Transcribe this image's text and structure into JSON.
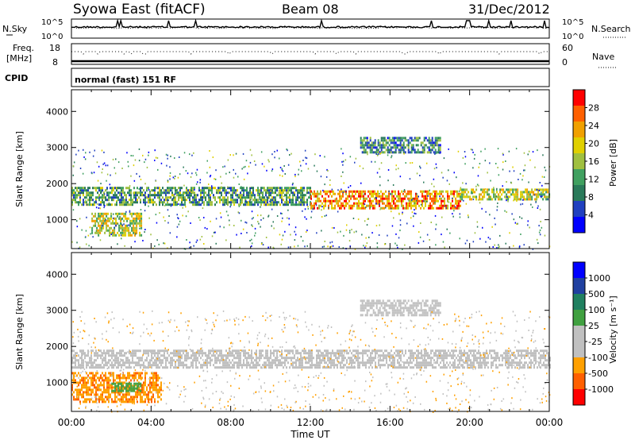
{
  "header": {
    "title": "Syowa East (fitACF)",
    "beam": "Beam 08",
    "date": "31/Dec/2012"
  },
  "strips": {
    "nsky_label": "N.Sky",
    "nsearch_label": "N.Search",
    "freq_label_1": "Freq.",
    "freq_label_2": "[MHz]",
    "nave_label": "Nave",
    "cpid_label": "CPID",
    "cpid_text": "normal (fast) 151 RF",
    "noise_ticks": [
      "10^5",
      "10^0"
    ],
    "freq_ticks": [
      "18",
      "8"
    ],
    "nave_ticks": [
      "60",
      "0"
    ]
  },
  "colors": {
    "power": [
      "#0000ff",
      "#2040c0",
      "#2a7a5a",
      "#40a060",
      "#a0c040",
      "#e0d000",
      "#f0a000",
      "#ff6000",
      "#ff0000"
    ],
    "velocity": [
      "#ff0000",
      "#ff6000",
      "#ffa000",
      "#c0c0c0",
      "#c0c0c0",
      "#40a040",
      "#208060",
      "#2040a0",
      "#0000ff"
    ],
    "ground_scatter": "#c0c0c0"
  },
  "chart_data": [
    {
      "type": "heatmap",
      "name": "power-panel",
      "xlabel": "",
      "ylabel": "Slant Range [km]",
      "xlim": [
        "00:00",
        "24:00"
      ],
      "ylim": [
        200,
        4600
      ],
      "y_ticks": [
        "4000",
        "3000",
        "2000",
        "1000"
      ],
      "y_tick_values": [
        4000,
        3000,
        2000,
        1000
      ],
      "colorbar": {
        "label": "Power [dB]",
        "ticks": [
          "28",
          "24",
          "20",
          "16",
          "12",
          "8",
          "4"
        ],
        "range": [
          0,
          32
        ]
      },
      "echo_bands": [
        {
          "t_start": 0.0,
          "t_end": 12.0,
          "r_low": 1450,
          "r_high": 1950,
          "level": 12
        },
        {
          "t_start": 12.0,
          "t_end": 19.5,
          "r_low": 1350,
          "r_high": 1850,
          "level": 24
        },
        {
          "t_start": 19.5,
          "t_end": 24.0,
          "r_low": 1600,
          "r_high": 1900,
          "level": 18
        },
        {
          "t_start": 14.5,
          "t_end": 18.5,
          "r_low": 2900,
          "r_high": 3350,
          "level": 10
        },
        {
          "t_start": 1.0,
          "t_end": 3.5,
          "r_low": 600,
          "r_high": 1200,
          "level": 18
        }
      ]
    },
    {
      "type": "heatmap",
      "name": "velocity-panel",
      "xlabel": "Time UT",
      "ylabel": "Slant Range [km]",
      "xlim": [
        "00:00",
        "24:00"
      ],
      "ylim": [
        200,
        4600
      ],
      "x_ticks": [
        "00:00",
        "04:00",
        "08:00",
        "12:00",
        "16:00",
        "20:00",
        "00:00"
      ],
      "y_ticks": [
        "4000",
        "3000",
        "2000",
        "1000"
      ],
      "y_tick_values": [
        4000,
        3000,
        2000,
        1000
      ],
      "colorbar": {
        "label": "Velocity [m s⁻¹]",
        "ticks": [
          "1000",
          "500",
          "100",
          "25",
          "-25",
          "-100",
          "-500",
          "-1000"
        ]
      },
      "echo_bands": [
        {
          "t_start": 0.0,
          "t_end": 24.0,
          "r_low": 1450,
          "r_high": 1950,
          "kind": "ground"
        },
        {
          "t_start": 14.5,
          "t_end": 18.5,
          "r_low": 2900,
          "r_high": 3350,
          "kind": "ground"
        },
        {
          "t_start": 0.0,
          "t_end": 4.5,
          "r_low": 500,
          "r_high": 1300,
          "kind": "negative"
        },
        {
          "t_start": 2.0,
          "t_end": 3.5,
          "r_low": 800,
          "r_high": 1000,
          "kind": "positive"
        }
      ]
    }
  ]
}
